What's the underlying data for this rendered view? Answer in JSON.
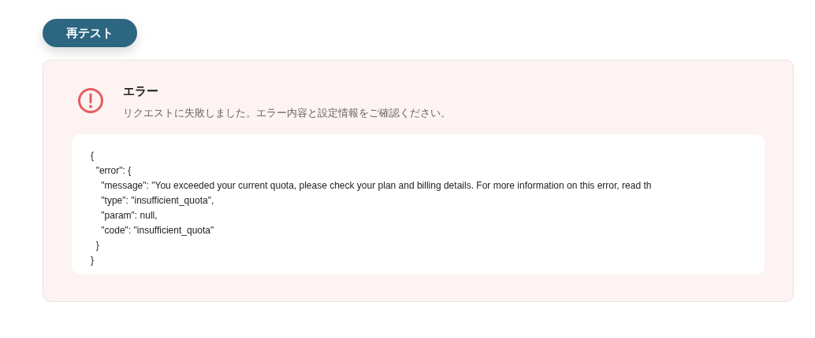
{
  "retest_button": {
    "label": "再テスト"
  },
  "error_panel": {
    "title": "エラー",
    "message": "リクエストに失敗しました。エラー内容と設定情報をご確認ください。",
    "code_lines": [
      "{",
      "  \"error\": {",
      "    \"message\": \"You exceeded your current quota, please check your plan and billing details. For more information on this error, read th",
      "    \"type\": \"insufficient_quota\",",
      "    \"param\": null,",
      "    \"code\": \"insufficient_quota\"",
      "  }",
      "}"
    ]
  }
}
